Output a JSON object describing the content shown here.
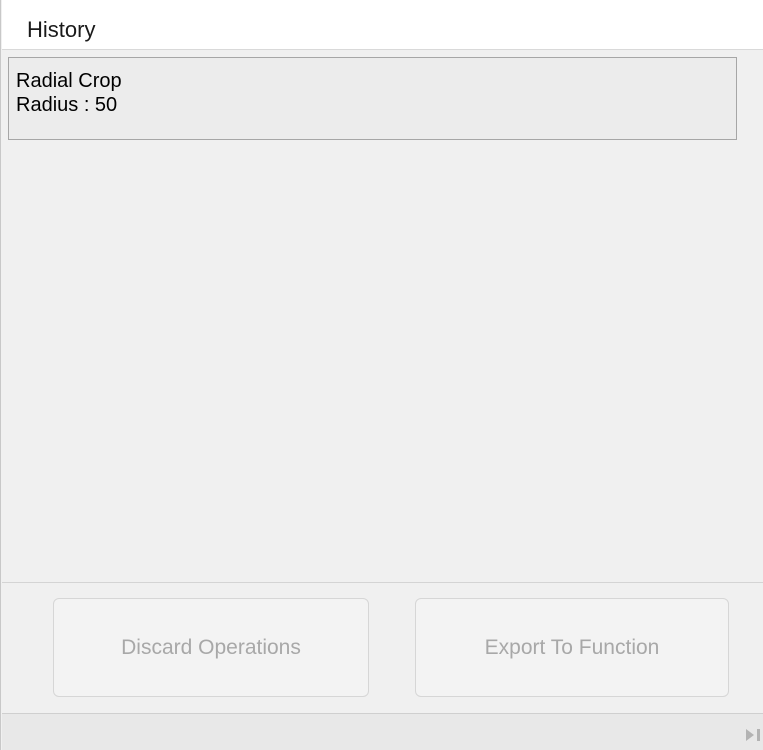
{
  "header": {
    "title": "History"
  },
  "history": {
    "items": [
      {
        "name": "Radial Crop",
        "detail": "Radius : 50"
      }
    ]
  },
  "buttons": {
    "discard_label": "Discard Operations",
    "export_label": "Export To Function"
  },
  "status_bar": {
    "icon": "expand-right-icon"
  }
}
